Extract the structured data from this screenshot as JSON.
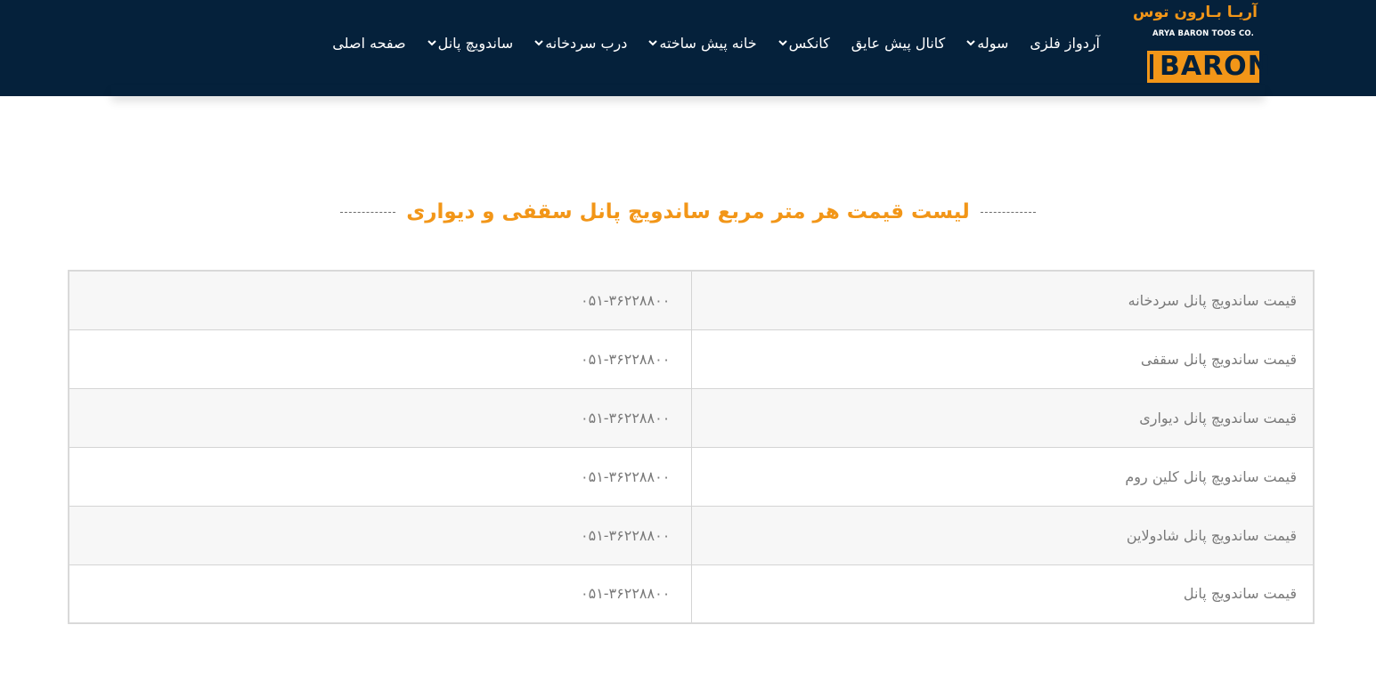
{
  "logo": {
    "fa_name": "آریـا بـارون توس",
    "en_name": "ARYA BARON TOOS CO.",
    "mark": "BARON"
  },
  "nav": {
    "items": [
      {
        "label": "صفحه اصلی",
        "has_dropdown": false
      },
      {
        "label": "ساندویچ پانل",
        "has_dropdown": true
      },
      {
        "label": "درب سردخانه",
        "has_dropdown": true
      },
      {
        "label": "خانه پیش ساخته",
        "has_dropdown": true
      },
      {
        "label": "کانکس",
        "has_dropdown": true
      },
      {
        "label": "کانال پیش عایق",
        "has_dropdown": false
      },
      {
        "label": "سوله",
        "has_dropdown": true
      },
      {
        "label": "آردواز فلزی",
        "has_dropdown": false
      }
    ]
  },
  "section": {
    "title": "لیست قیمت هر متر مربع ساندویچ پانل سقفی و دیواری"
  },
  "price_table": {
    "rows": [
      {
        "name": "قیمت ساندویچ پانل سردخانه",
        "phone": "۰۵۱-۳۶۲۲۸۸۰۰"
      },
      {
        "name": "قیمت ساندویچ پانل سقفی",
        "phone": "۰۵۱-۳۶۲۲۸۸۰۰"
      },
      {
        "name": "قیمت ساندویچ پانل دیواری",
        "phone": "۰۵۱-۳۶۲۲۸۸۰۰"
      },
      {
        "name": "قیمت ساندویچ پانل کلین روم",
        "phone": "۰۵۱-۳۶۲۲۸۸۰۰"
      },
      {
        "name": "قیمت ساندویچ پانل شادولاین",
        "phone": "۰۵۱-۳۶۲۲۸۸۰۰"
      },
      {
        "name": "قیمت ساندویچ پانل",
        "phone": "۰۵۱-۳۶۲۲۸۸۰۰"
      }
    ]
  },
  "colors": {
    "header_bg": "#05213b",
    "accent": "#f29618",
    "text_muted": "#7a7a7a"
  }
}
